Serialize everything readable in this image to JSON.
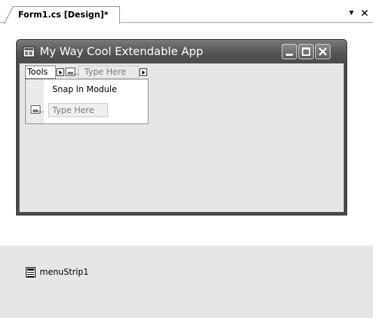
{
  "document_tab": {
    "title": "Form1.cs [Design]*",
    "dropdown_glyph": "▾",
    "close_glyph": "✕"
  },
  "form": {
    "title": "My Way Cool Extendable App",
    "icon": "form-icon"
  },
  "menustrip": {
    "top_item": "Tools",
    "placeholder": "Type Here",
    "dropdown": {
      "items": [
        "Snap In Module"
      ],
      "placeholder": "Type Here"
    }
  },
  "tray": {
    "component": "menuStrip1",
    "icon": "menustrip-icon"
  },
  "colors": {
    "titlebar": "#555555",
    "client": "#e6e6e6",
    "tray": "#e6e6e6"
  }
}
